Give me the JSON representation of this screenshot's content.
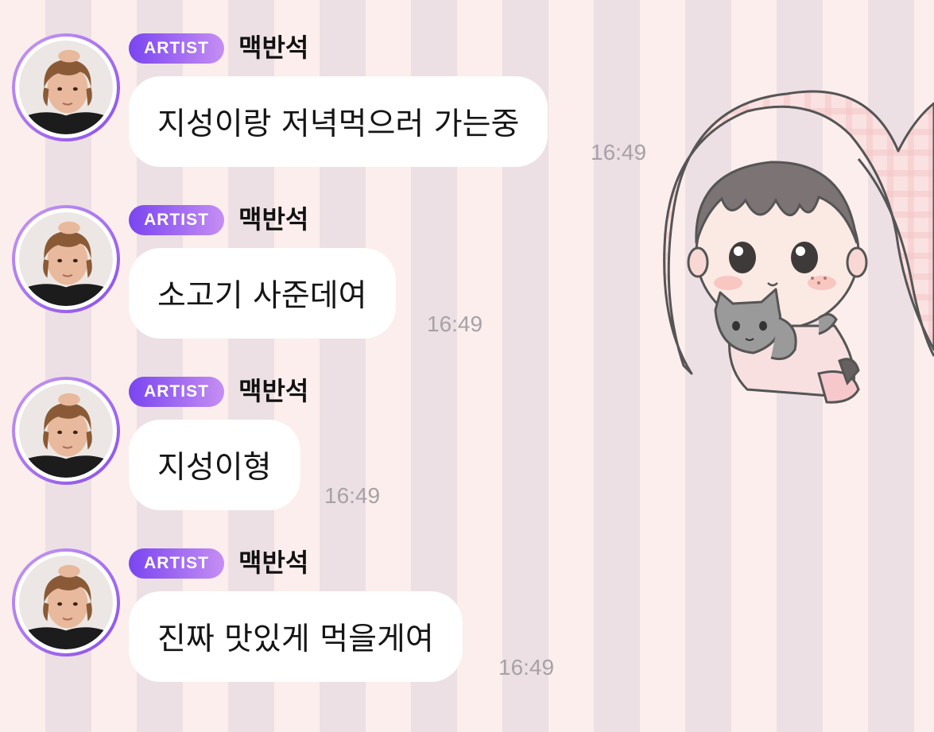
{
  "colors": {
    "badge_gradient_start": "#7a45f0",
    "badge_gradient_end": "#c58ef3",
    "bubble_bg": "#ffffff",
    "timestamp": "#a7a2a6",
    "stripe_light": "#fbeeec",
    "stripe_dark": "#ece0e5"
  },
  "messages": [
    {
      "badge": "ARTIST",
      "sender": "맥반석",
      "text": "지성이랑 저녁먹으러 가는중",
      "time": "16:49",
      "avatar_icon": "profile-photo"
    },
    {
      "badge": "ARTIST",
      "sender": "맥반석",
      "text": "소고기 사준데여",
      "time": "16:49",
      "avatar_icon": "profile-photo"
    },
    {
      "badge": "ARTIST",
      "sender": "맥반석",
      "text": "지성이형",
      "time": "16:49",
      "avatar_icon": "profile-photo"
    },
    {
      "badge": "ARTIST",
      "sender": "맥반석",
      "text": "진짜 맛있게 먹을게여",
      "time": "16:49",
      "avatar_icon": "profile-photo"
    }
  ],
  "sticker": {
    "icon": "chibi-with-cat-sticker"
  }
}
